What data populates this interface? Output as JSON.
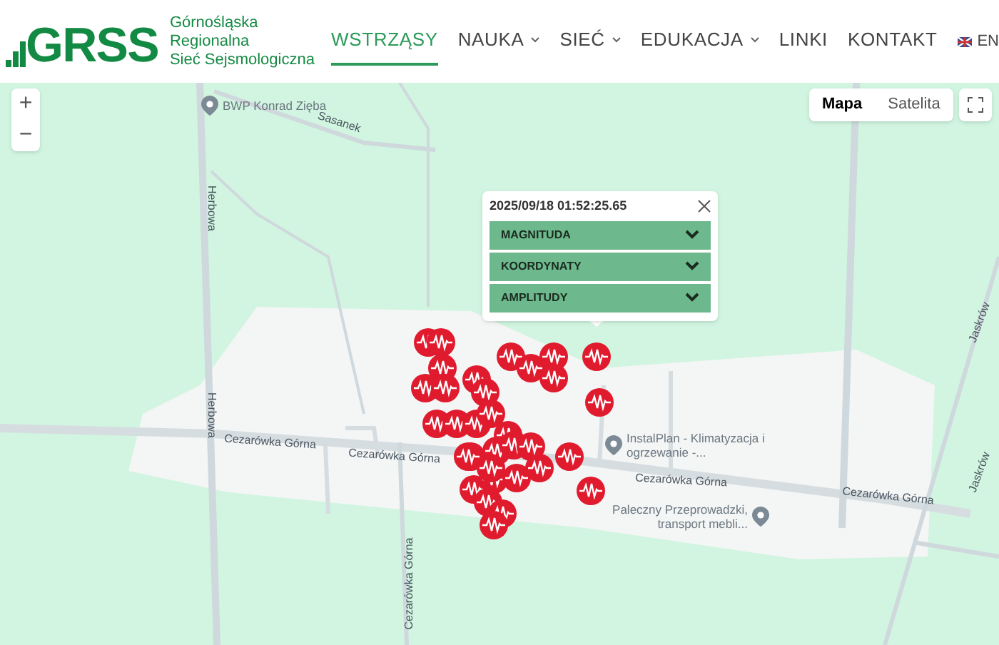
{
  "logo": {
    "mark": "GRSS",
    "lines": [
      "Górnośląska",
      "Regionalna",
      "Sieć Sejsmologiczna"
    ]
  },
  "nav": [
    {
      "label": "WSTRZĄSY",
      "selected": true,
      "dropdown": false
    },
    {
      "label": "NAUKA",
      "selected": false,
      "dropdown": true
    },
    {
      "label": "SIEĆ",
      "selected": false,
      "dropdown": true
    },
    {
      "label": "EDUKACJA",
      "selected": false,
      "dropdown": true
    },
    {
      "label": "LINKI",
      "selected": false,
      "dropdown": false
    },
    {
      "label": "KONTAKT",
      "selected": false,
      "dropdown": false
    }
  ],
  "language": "EN",
  "map_types": [
    {
      "label": "Mapa",
      "selected": true
    },
    {
      "label": "Satelita",
      "selected": false
    }
  ],
  "zoom": {
    "in": "+",
    "out": "−"
  },
  "places": [
    {
      "kind": "poi",
      "label": "BWP Konrad Zięba"
    },
    {
      "kind": "poi",
      "label": "InstalPlan - Klimatyzacja i ogrzewanie -..."
    },
    {
      "kind": "poi",
      "label": "Paleczny Przeprowadzki, transport mebli..."
    }
  ],
  "streets": [
    "Sasanek",
    "Herbowa",
    "Herbowa",
    "Cezarówka Górna",
    "Cezarówka Górna",
    "Cezarówka Górna",
    "Cezarówka Górna",
    "Cezarówka Górna",
    "Jaskrów",
    "Jaskrów"
  ],
  "popup": {
    "title": "2025/09/18 01:52:25.65",
    "sections": [
      {
        "label": "MAGNITUDA",
        "expanded": false
      },
      {
        "label": "KOORDYNATY",
        "expanded": false
      },
      {
        "label": "AMPLITUDY",
        "expanded": false
      }
    ]
  }
}
